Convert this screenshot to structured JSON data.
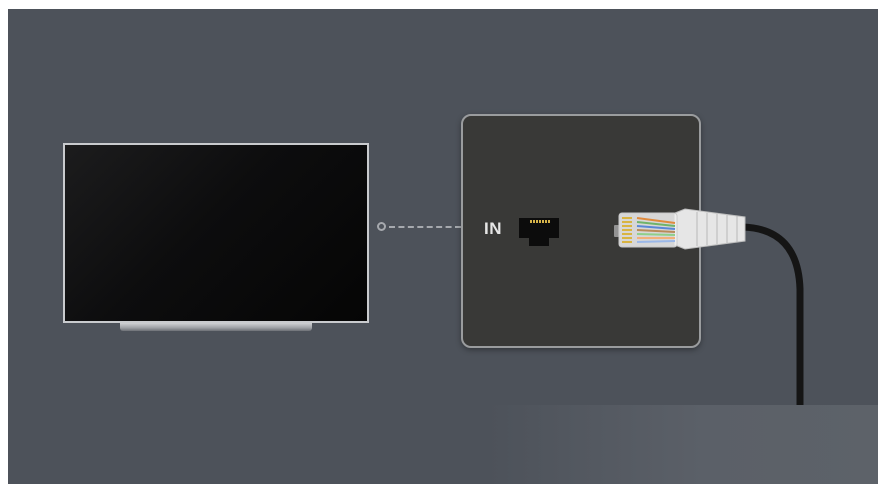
{
  "wall_plate": {
    "port_label": "IN"
  },
  "icons": {
    "tv": "tv-icon",
    "jack": "ethernet-port-icon",
    "cable": "ethernet-cable-icon"
  },
  "colors": {
    "background": "#4d525a",
    "plate": "#393937",
    "tv_screen": "#0d0d0e",
    "cable_boot": "#e8e8e8"
  }
}
